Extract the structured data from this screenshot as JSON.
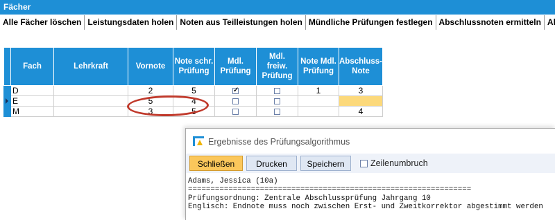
{
  "window": {
    "title": "Fächer"
  },
  "toolbar": {
    "items": [
      "Alle Fächer löschen",
      "Leistungsdaten holen",
      "Noten aus Teilleistungen holen",
      "Mündliche Prüfungen festlegen",
      "Abschlussnoten ermitteln",
      "Abschlussnoten i"
    ]
  },
  "grid": {
    "headers": {
      "fach": "Fach",
      "lehrkraft": "Lehrkraft",
      "vornote": "Vornote",
      "note_schr_1": "Note schr.",
      "note_schr_2": "Prüfung",
      "mdl_1": "Mdl.",
      "mdl_2": "Prüfung",
      "mdl_freiw_1": "Mdl.",
      "mdl_freiw_2": "freiw.",
      "mdl_freiw_3": "Prüfung",
      "note_mdl_1": "Note Mdl.",
      "note_mdl_2": "Prüfung",
      "abschluss_1": "Abschluss-",
      "abschluss_2": "Note"
    },
    "rows": [
      {
        "fach": "D",
        "lehrkraft": "",
        "vornote": "2",
        "note_schr": "5",
        "mdl_pruefung": true,
        "mdl_freiw": false,
        "note_mdl": "1",
        "abschlussnote": "3",
        "selected": false
      },
      {
        "fach": "E",
        "lehrkraft": "",
        "vornote": "5",
        "note_schr": "4",
        "mdl_pruefung": false,
        "mdl_freiw": false,
        "note_mdl": "",
        "abschlussnote": "",
        "selected": true
      },
      {
        "fach": "M",
        "lehrkraft": "",
        "vornote": "3",
        "note_schr": "5",
        "mdl_pruefung": false,
        "mdl_freiw": false,
        "note_mdl": "",
        "abschlussnote": "4",
        "selected": false
      }
    ]
  },
  "dialog": {
    "title": "Ergebnisse des Prüfungsalgorithmus",
    "buttons": {
      "close": "Schließen",
      "print": "Drucken",
      "save": "Speichern"
    },
    "wrap_label": "Zeilenumbruch",
    "wrap_checked": false,
    "lines": [
      "Adams, Jessica (10a)",
      "===============================================================",
      "Prüfungsordnung: Zentrale Abschlussprüfung Jahrgang 10",
      "Englisch: Endnote muss noch zwischen Erst- und Zweitkorrektor abgestimmt werden"
    ]
  },
  "colors": {
    "accent": "#1e8fd6",
    "highlight": "#fcd97b",
    "annotation": "#c0392b",
    "primary_button": "#fbc75b"
  }
}
